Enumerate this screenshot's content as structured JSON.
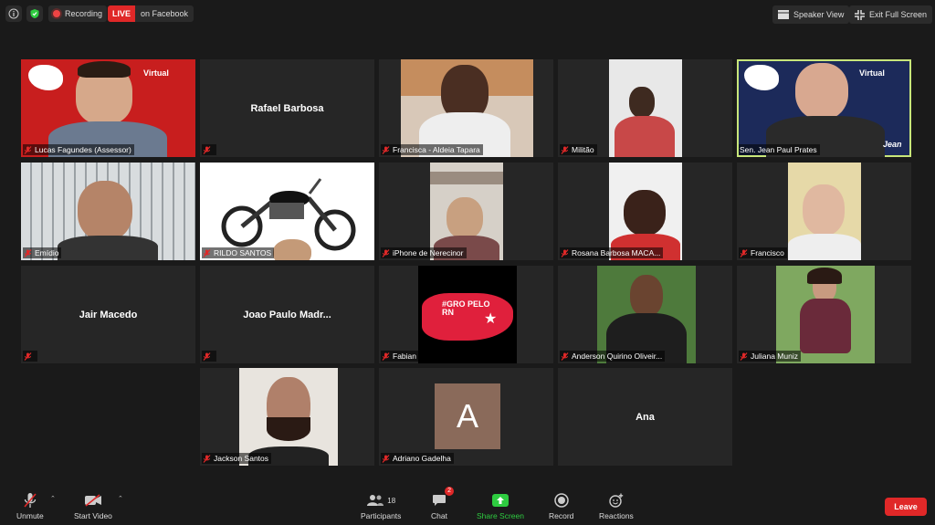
{
  "topbar": {
    "recording_label": "Recording",
    "live_badge": "LIVE",
    "live_target": "on Facebook",
    "speaker_view": "Speaker View",
    "exit_full_screen": "Exit Full Screen"
  },
  "participants": [
    {
      "name": "Lucas Fagundes (Assessor)",
      "banner": "Virtual"
    },
    {
      "name": "Rafael Barbosa"
    },
    {
      "name": "Francisca - Aldeia Tapara"
    },
    {
      "name": "Militão"
    },
    {
      "name": "Sen. Jean Paul Prates",
      "banner": "Virtual",
      "brand": "Jean"
    },
    {
      "name": "Emídio"
    },
    {
      "name": "RILDO SANTOS"
    },
    {
      "name": "iPhone de Nerecinor"
    },
    {
      "name": "Rosana Barbosa  MACA..."
    },
    {
      "name": "Francisco"
    },
    {
      "name": "Jair Macedo"
    },
    {
      "name": "Joao  Paulo  Madr..."
    },
    {
      "name": "Fabian",
      "logo": "#GRO PELO RN"
    },
    {
      "name": "Anderson Quirino Oliveir..."
    },
    {
      "name": "Juliana Muniz"
    },
    {
      "name": "Jackson Santos"
    },
    {
      "name": "Adriano Gadelha",
      "initial": "A"
    },
    {
      "name": "Ana"
    }
  ],
  "toolbar": {
    "unmute": "Unmute",
    "start_video": "Start Video",
    "participants": "Participants",
    "participants_count": "18",
    "chat": "Chat",
    "chat_badge": "2",
    "share_screen": "Share Screen",
    "record": "Record",
    "reactions": "Reactions",
    "leave": "Leave"
  },
  "colors": {
    "accent_green": "#2ecc40",
    "leave_red": "#e02828",
    "active_speaker": "#c8e67a",
    "muted_mic": "#e02828"
  }
}
